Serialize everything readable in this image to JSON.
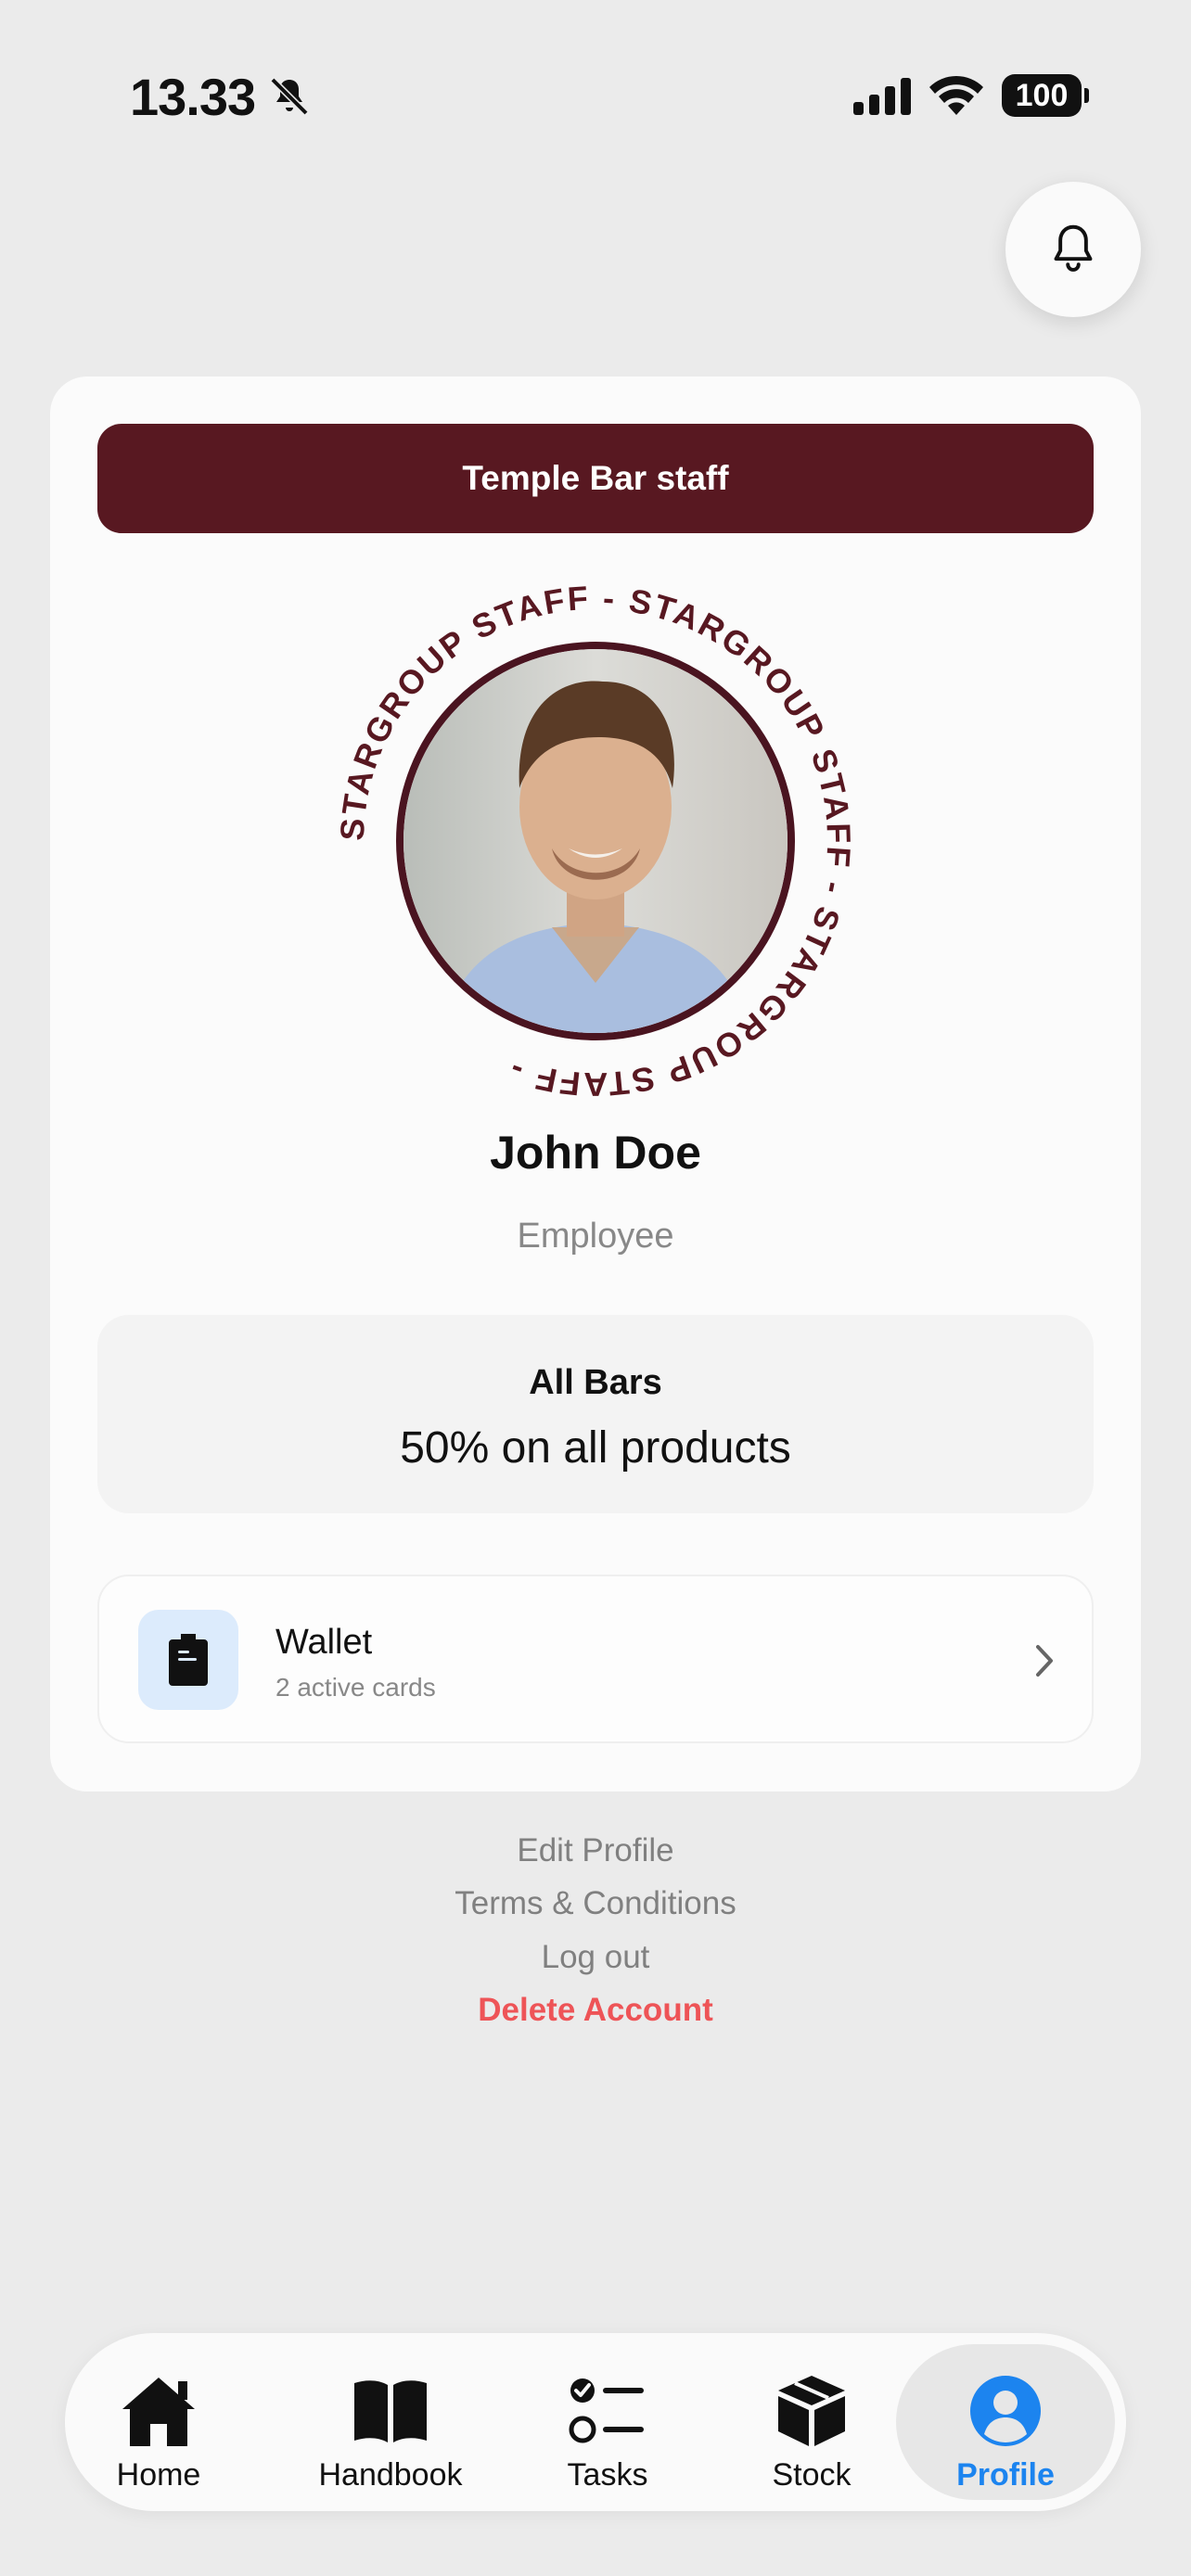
{
  "status_bar": {
    "time": "13.33",
    "battery": "100"
  },
  "profile": {
    "banner": "Temple Bar staff",
    "ring_text": "STARGROUP STAFF - STARGROUP STAFF - STARGROUP STAFF - ",
    "name": "John Doe",
    "role": "Employee"
  },
  "discount": {
    "title": "All Bars",
    "value": "50% on all products"
  },
  "wallet": {
    "title": "Wallet",
    "subtitle": "2 active cards"
  },
  "links": {
    "edit_profile": "Edit Profile",
    "terms": "Terms & Conditions",
    "logout": "Log out",
    "delete_account": "Delete Account"
  },
  "tabs": [
    {
      "label": "Home",
      "icon": "house-icon"
    },
    {
      "label": "Handbook",
      "icon": "book-icon"
    },
    {
      "label": "Tasks",
      "icon": "checklist-icon"
    },
    {
      "label": "Stock",
      "icon": "box-icon"
    },
    {
      "label": "Profile",
      "icon": "user-circle-icon",
      "active": true
    }
  ],
  "colors": {
    "brand": "#581821",
    "active": "#1c84ef",
    "danger": "#ee5457",
    "background": "#ebebeb"
  }
}
